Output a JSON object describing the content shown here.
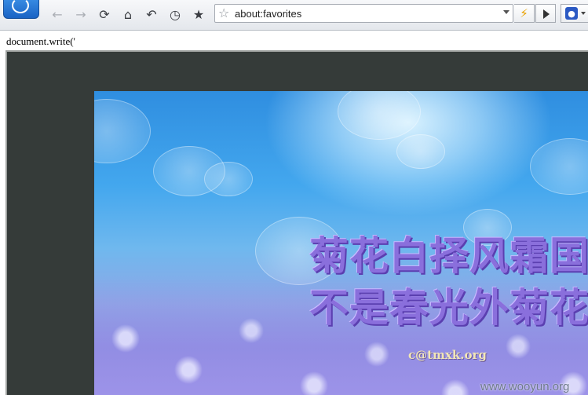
{
  "toolbar": {
    "address_url": "about:favorites",
    "icons": {
      "back": "back-arrow-icon",
      "forward": "forward-arrow-icon",
      "refresh": "refresh-icon",
      "home": "home-icon",
      "undo": "undo-icon",
      "history": "history-icon",
      "favorites": "favorites-star-icon"
    }
  },
  "page": {
    "script_text": "document.write('",
    "banner": {
      "line1": "菊花白择风霜国",
      "line2": "不是春光外菊花",
      "credit": "c@tmxk.org"
    },
    "watermark": "www.wooyun.org"
  },
  "colors": {
    "poem_text": "#8a6fdc",
    "frame_bg": "#353b39",
    "accent": "#1a63c4"
  }
}
